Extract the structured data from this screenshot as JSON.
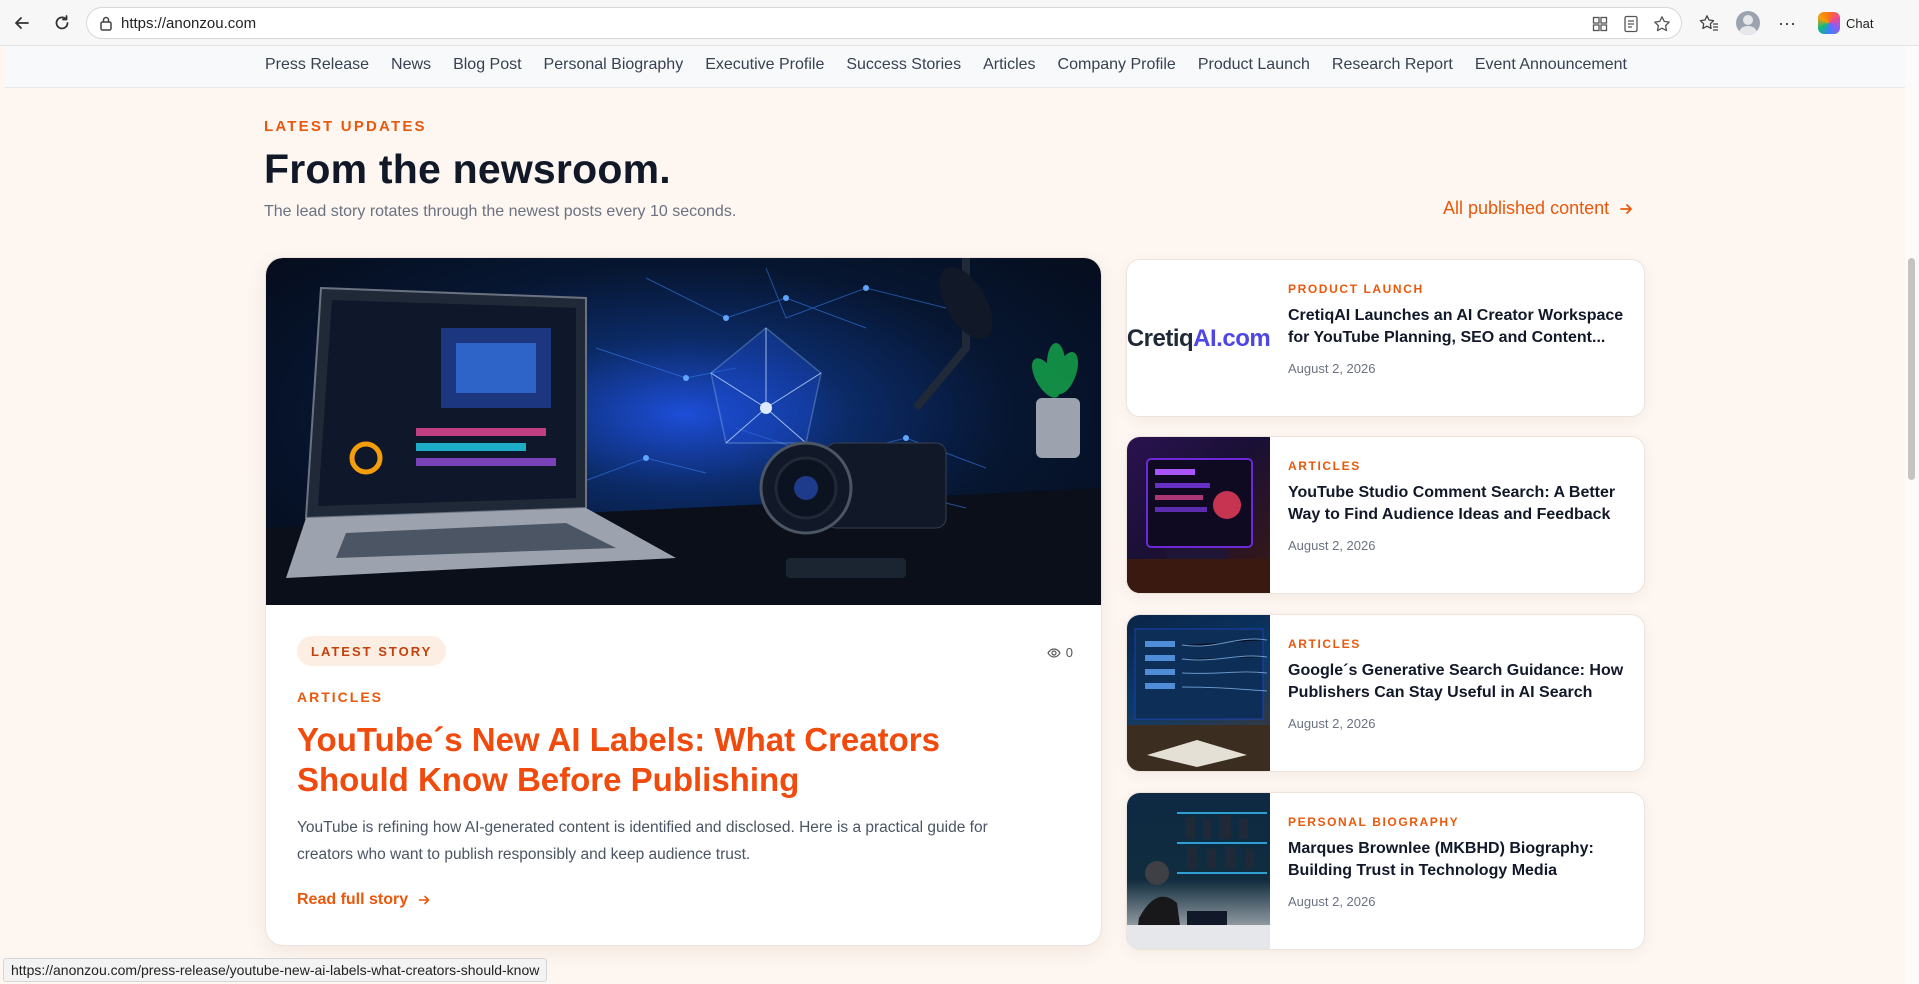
{
  "browser": {
    "url": "https://anonzou.com",
    "chat_label": "Chat"
  },
  "nav": {
    "items": [
      "Press Release",
      "News",
      "Blog Post",
      "Personal Biography",
      "Executive Profile",
      "Success Stories",
      "Articles",
      "Company Profile",
      "Product Launch",
      "Research Report",
      "Event Announcement"
    ]
  },
  "header": {
    "eyebrow": "LATEST UPDATES",
    "title": "From the newsroom.",
    "subtitle": "The lead story rotates through the newest posts every 10 seconds.",
    "all_link": "All published content"
  },
  "lead": {
    "badge": "LATEST STORY",
    "views": "0",
    "category": "ARTICLES",
    "title": "YouTube´s New AI Labels: What Creators Should Know Before Publishing",
    "excerpt": "YouTube is refining how AI-generated content is identified and disclosed. Here is a practical guide for creators who want to publish responsibly and keep audience trust.",
    "read_more": "Read full story"
  },
  "side": [
    {
      "category": "PRODUCT LAUNCH",
      "title": "CretiqAI Launches an AI Creator Workspace for YouTube Planning, SEO and Content...",
      "date": "August 2, 2026",
      "thumb_logo_a": "Cretiq",
      "thumb_logo_b": "AI.com"
    },
    {
      "category": "ARTICLES",
      "title": "YouTube Studio Comment Search: A Better Way to Find Audience Ideas and Feedback",
      "date": "August 2, 2026"
    },
    {
      "category": "ARTICLES",
      "title": "Google´s Generative Search Guidance: How Publishers Can Stay Useful in AI Search",
      "date": "August 2, 2026"
    },
    {
      "category": "PERSONAL BIOGRAPHY",
      "title": "Marques Brownlee (MKBHD) Biography: Building Trust in Technology Media",
      "date": "August 2, 2026"
    }
  ],
  "status_url": "https://anonzou.com/press-release/youtube-new-ai-labels-what-creators-should-know",
  "colors": {
    "accent": "#ea580c",
    "lead_title": "#f04a0c",
    "page_bg": "#fdf6f1"
  }
}
